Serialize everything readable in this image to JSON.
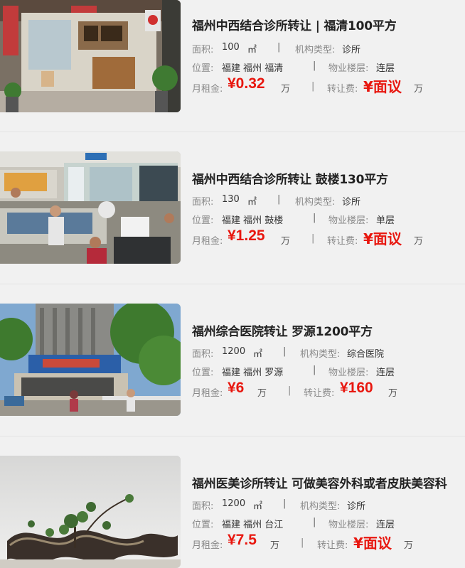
{
  "listings": [
    {
      "title": "福州中西结合诊所转让 | 福清100平方",
      "area_label": "面积:",
      "area_value": "100",
      "area_unit": "㎡",
      "type_label": "机构类型:",
      "type_value": "诊所",
      "location_label": "位置:",
      "location_value": "福建 福州 福清",
      "floor_label": "物业楼层:",
      "floor_value": "连层",
      "rent_label": "月租金:",
      "rent_value": "¥0.32",
      "rent_unit": "万",
      "fee_label": "转让费:",
      "fee_value": "¥面议",
      "fee_unit": "万",
      "separator": "|"
    },
    {
      "title": "福州中西结合诊所转让 鼓楼130平方",
      "area_label": "面积:",
      "area_value": "130",
      "area_unit": "㎡",
      "type_label": "机构类型:",
      "type_value": "诊所",
      "location_label": "位置:",
      "location_value": "福建 福州 鼓楼",
      "floor_label": "物业楼层:",
      "floor_value": "单层",
      "rent_label": "月租金:",
      "rent_value": "¥1.25",
      "rent_unit": "万",
      "fee_label": "转让费:",
      "fee_value": "¥面议",
      "fee_unit": "万",
      "separator": "|"
    },
    {
      "title": "福州综合医院转让 罗源1200平方",
      "area_label": "面积:",
      "area_value": "1200",
      "area_unit": "㎡",
      "type_label": "机构类型:",
      "type_value": "综合医院",
      "location_label": "位置:",
      "location_value": "福建 福州 罗源",
      "floor_label": "物业楼层:",
      "floor_value": "连层",
      "rent_label": "月租金:",
      "rent_value": "¥6",
      "rent_unit": "万",
      "fee_label": "转让费:",
      "fee_value": "¥160",
      "fee_unit": "万",
      "separator": "|"
    },
    {
      "title": "福州医美诊所转让 可做美容外科或者皮肤美容科",
      "area_label": "面积:",
      "area_value": "1200",
      "area_unit": "㎡",
      "type_label": "机构类型:",
      "type_value": "诊所",
      "location_label": "位置:",
      "location_value": "福建 福州 台江",
      "floor_label": "物业楼层:",
      "floor_value": "连层",
      "rent_label": "月租金:",
      "rent_value": "¥7.5",
      "rent_unit": "万",
      "fee_label": "转让费:",
      "fee_value": "¥面议",
      "fee_unit": "万",
      "separator": "|"
    }
  ],
  "colors": {
    "price": "#e8170f",
    "background": "#f1f1f1",
    "title": "#222222",
    "label": "#888888"
  }
}
